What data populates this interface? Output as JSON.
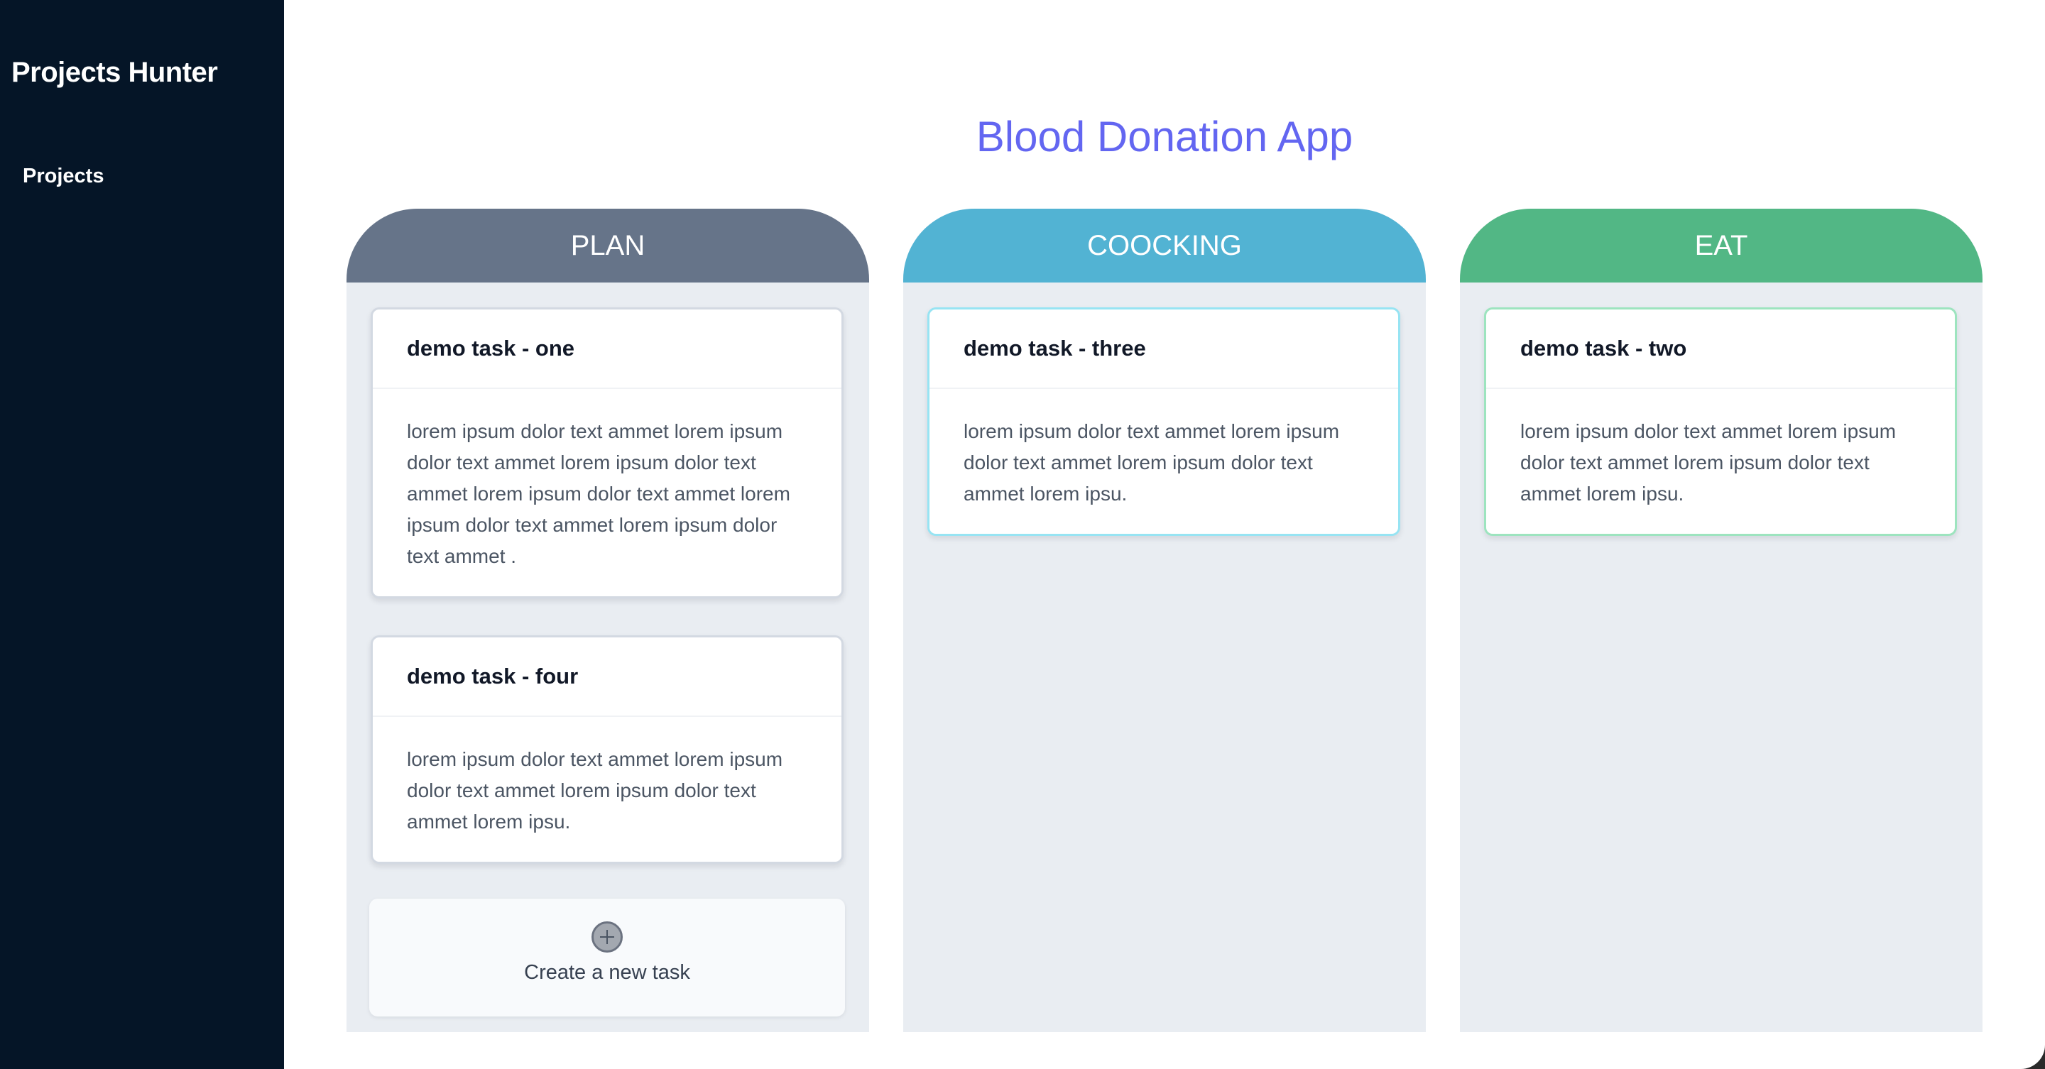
{
  "sidebar": {
    "brand": "Projects Hunter",
    "nav": [
      {
        "label": "Projects"
      }
    ]
  },
  "main": {
    "title": "Blood Donation App",
    "title_color": "#6366f1",
    "columns": [
      {
        "name": "PLAN",
        "color": "#667489",
        "tasks": [
          {
            "title": "demo task - one",
            "body": "lorem ipsum dolor text ammet lorem ipsum dolor text ammet lorem ipsum dolor text ammet lorem ipsum dolor text ammet lorem ipsum dolor text ammet lorem ipsum dolor text ammet ."
          },
          {
            "title": "demo task - four",
            "body": "lorem ipsum dolor text ammet lorem ipsum dolor text ammet lorem ipsum dolor text ammet lorem ipsu."
          }
        ],
        "create_label": "Create a new task",
        "create_icon": "plus-circle-icon"
      },
      {
        "name": "COOCKING",
        "color": "#52b3d3",
        "tasks": [
          {
            "title": "demo task - three",
            "body": "lorem ipsum dolor text ammet lorem ipsum dolor text ammet lorem ipsum dolor text ammet lorem ipsu."
          }
        ]
      },
      {
        "name": "EAT",
        "color": "#52b785",
        "tasks": [
          {
            "title": "demo task - two",
            "body": "lorem ipsum dolor text ammet lorem ipsum dolor text ammet lorem ipsum dolor text ammet lorem ipsu."
          }
        ]
      }
    ]
  }
}
